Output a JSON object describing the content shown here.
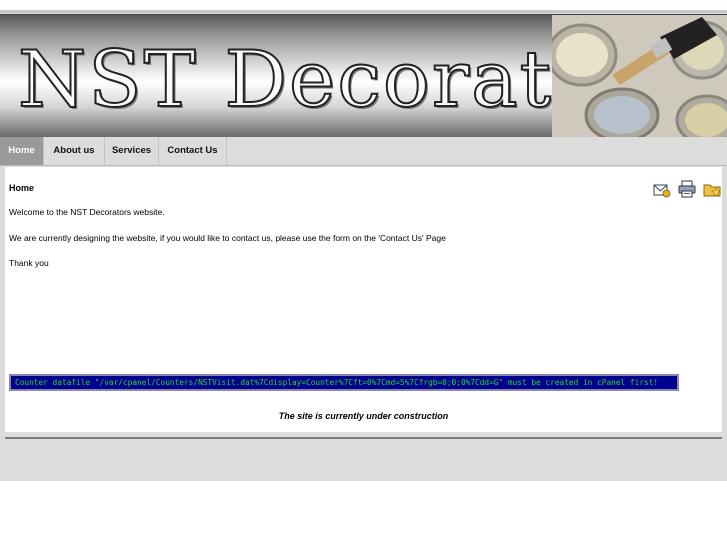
{
  "site": {
    "title": "NST Decorators"
  },
  "nav": {
    "items": [
      {
        "label": "Home",
        "active": true
      },
      {
        "label": "About us",
        "active": false
      },
      {
        "label": "Services",
        "active": false
      },
      {
        "label": "Contact Us",
        "active": false
      }
    ]
  },
  "content": {
    "heading": "Home",
    "paragraphs": [
      "Welcome to the NST Decorators website.",
      "We are currently designing the website, if you would like to contact us, please use the form on the 'Contact Us' Page",
      "Thank you"
    ],
    "counter_error": "Counter datafile \"/var/cpanel/Counters/NSTVisit.dat%7Cdisplay=Counter%7Cft=0%7Cmd=5%7Cfrgb=0;0;0%7Cdd=G\" must be created in cPanel first!",
    "footer_note": "The site is currently under construction"
  },
  "icons": [
    "email-icon",
    "print-icon",
    "favorite-icon"
  ],
  "colors": {
    "nav_active_bg": "#9a9a9a",
    "counter_bg": "#000090",
    "counter_text": "#22dd22",
    "page_bg": "#dcdcdc"
  }
}
